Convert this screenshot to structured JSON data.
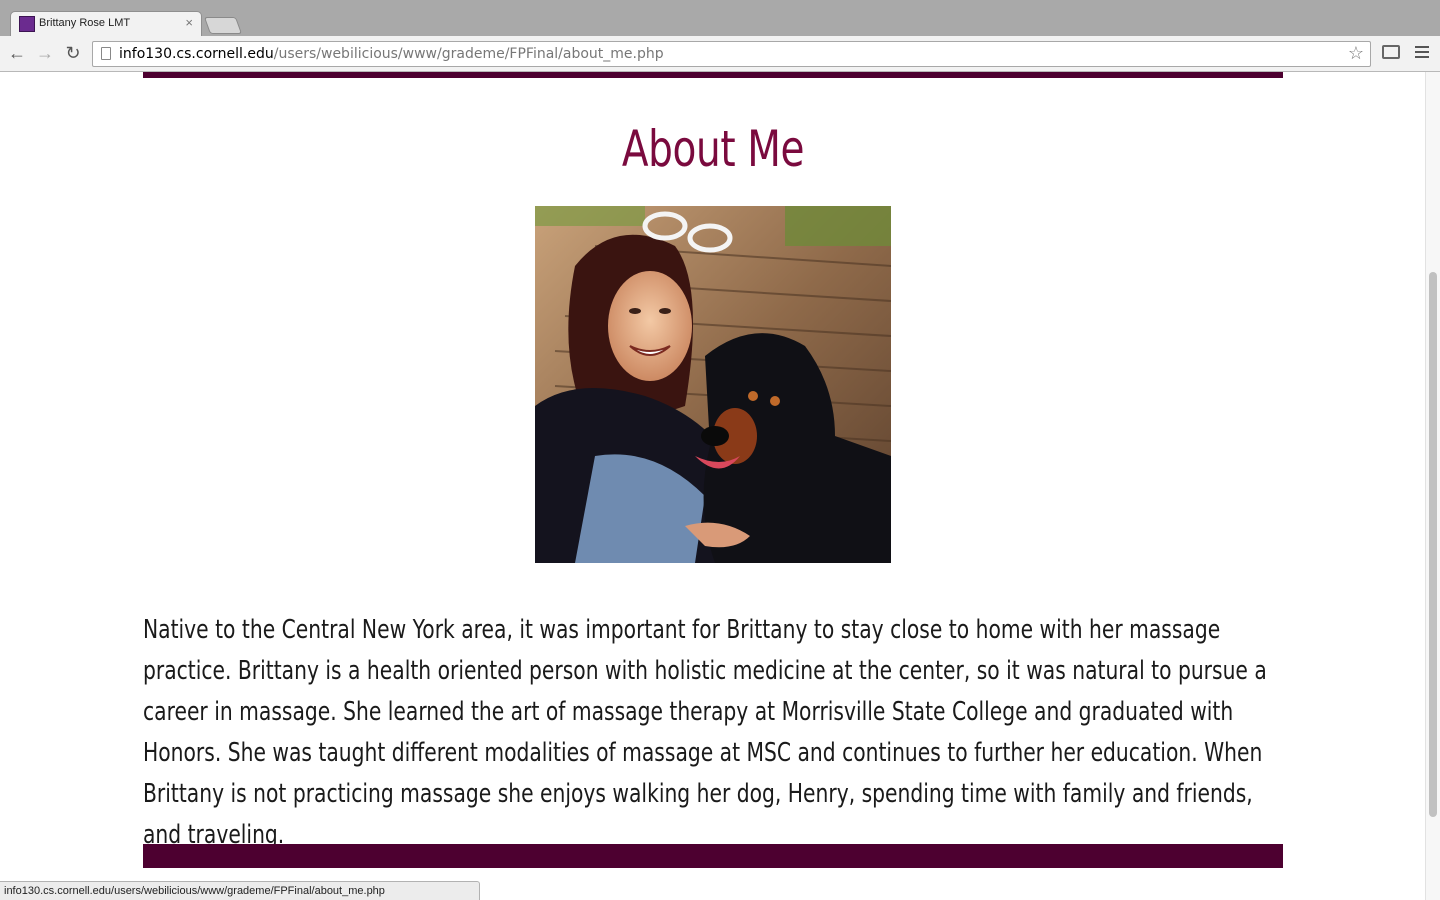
{
  "browser": {
    "tab_title": "Brittany Rose LMT",
    "tab_close": "×",
    "url_host": "info130.cs.cornell.edu",
    "url_path": "/users/webilicious/www/grademe/FPFinal/about_me.php",
    "status_url": "info130.cs.cornell.edu/users/webilicious/www/grademe/FPFinal/about_me.php",
    "back_glyph": "←",
    "forward_glyph": "→",
    "reload_glyph": "↻",
    "star_glyph": "☆"
  },
  "page": {
    "heading": "About Me",
    "photo_alt": "Brittany with her dog Henry",
    "bio": "Native to the Central New York area, it was important for Brittany to stay close to home with her massage practice. Brittany is a health oriented person with holistic medicine at the center, so it was natural to pursue a career in massage. She learned the art of massage therapy at Morrisville State College and graduated with Honors. She was taught different modalities of massage at MSC and continues to further her education. When Brittany is not practicing massage she enjoys walking her dog, Henry, spending time with family and friends, and traveling."
  },
  "colors": {
    "accent_bar": "#4d0030",
    "heading": "#7a0a3e"
  },
  "icons": [
    "favicon-icon",
    "back-arrow-icon",
    "forward-arrow-icon",
    "reload-icon",
    "page-icon",
    "star-icon",
    "cast-icon",
    "menu-icon"
  ]
}
